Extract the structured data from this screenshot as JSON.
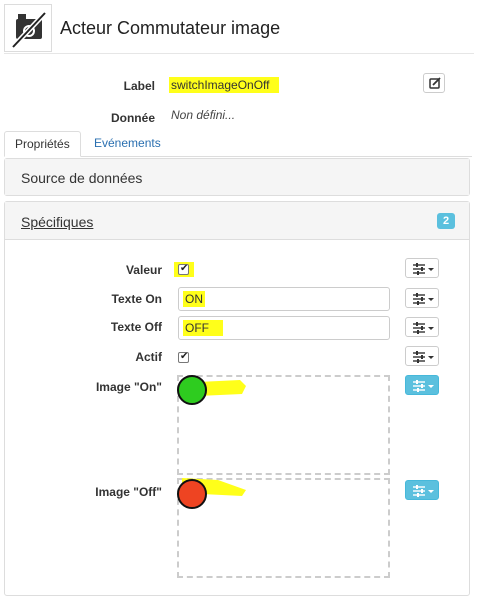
{
  "header": {
    "title": "Acteur Commutateur image",
    "logo_icon": "switch-image-off-icon"
  },
  "properties": {
    "label_caption": "Label",
    "label_value": "switchImageOnOff",
    "donnee_caption": "Donnée",
    "donnee_value": "Non défini..."
  },
  "tabs": [
    {
      "label": "Propriétés",
      "active": true
    },
    {
      "label": "Evénements",
      "active": false
    }
  ],
  "panels": {
    "source": {
      "title": "Source de données"
    },
    "specifiques": {
      "title": "Spécifiques",
      "badge": "2"
    }
  },
  "fields": {
    "valeur": {
      "label": "Valeur",
      "checked": true
    },
    "texte_on": {
      "label": "Texte On",
      "value": "ON"
    },
    "texte_off": {
      "label": "Texte Off",
      "value": "OFF"
    },
    "actif": {
      "label": "Actif",
      "checked": true
    },
    "image_on": {
      "label": "Image \"On\"",
      "color": "#2ecc1f"
    },
    "image_off": {
      "label": "Image \"Off\"",
      "color": "#ee4422"
    }
  },
  "colors": {
    "highlight": "#ffff1a",
    "accent": "#5bc0de",
    "link": "#2a6fb0"
  }
}
